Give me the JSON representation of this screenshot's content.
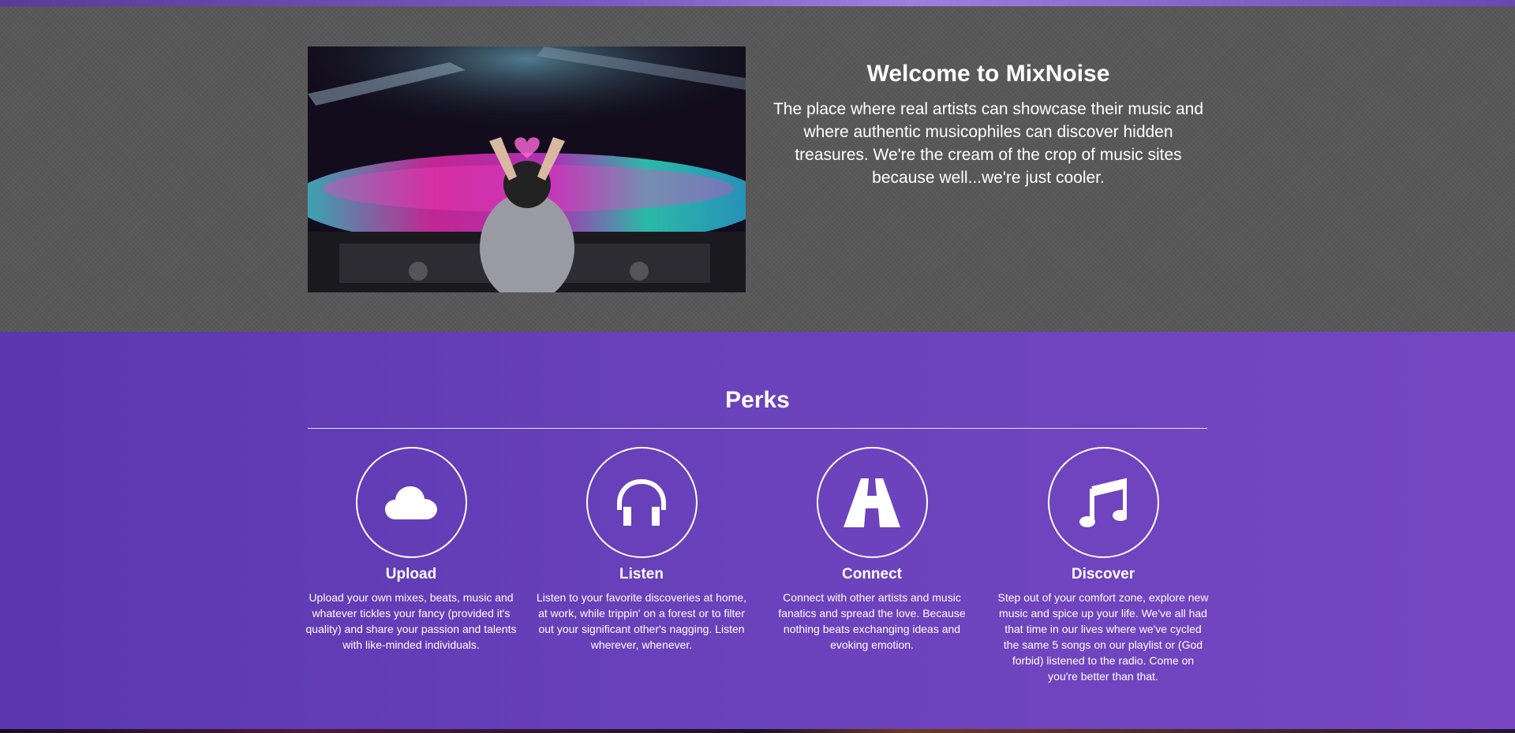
{
  "hero": {
    "title": "Welcome to MixNoise",
    "description": "The place where real artists can showcase their music and where authentic musicophiles can discover hidden treasures. We're the cream of the crop of music sites because well...we're just cooler."
  },
  "perks": {
    "title": "Perks",
    "items": [
      {
        "icon": "cloud-icon",
        "title": "Upload",
        "description": "Upload your own mixes, beats, music and whatever tickles your fancy (provided it's quality) and share your passion and talents with like-minded individuals."
      },
      {
        "icon": "headphones-icon",
        "title": "Listen",
        "description": "Listen to your favorite discoveries at home, at work, while trippin' on a forest or to filter out your significant other's nagging. Listen wherever, whenever."
      },
      {
        "icon": "road-icon",
        "title": "Connect",
        "description": "Connect with other artists and music fanatics and spread the love. Because nothing beats exchanging ideas and evoking emotion."
      },
      {
        "icon": "music-note-icon",
        "title": "Discover",
        "description": "Step out of your comfort zone, explore new music and spice up your life. We've all had that time in our lives where we've cycled the same 5 songs on our playlist or (God forbid) listened to the radio. Come on you're better than that."
      }
    ]
  },
  "colors": {
    "hero_bg": "#585858",
    "perks_bg_start": "#5a37b0",
    "perks_bg_end": "#7746c2",
    "text": "#ffffff"
  }
}
